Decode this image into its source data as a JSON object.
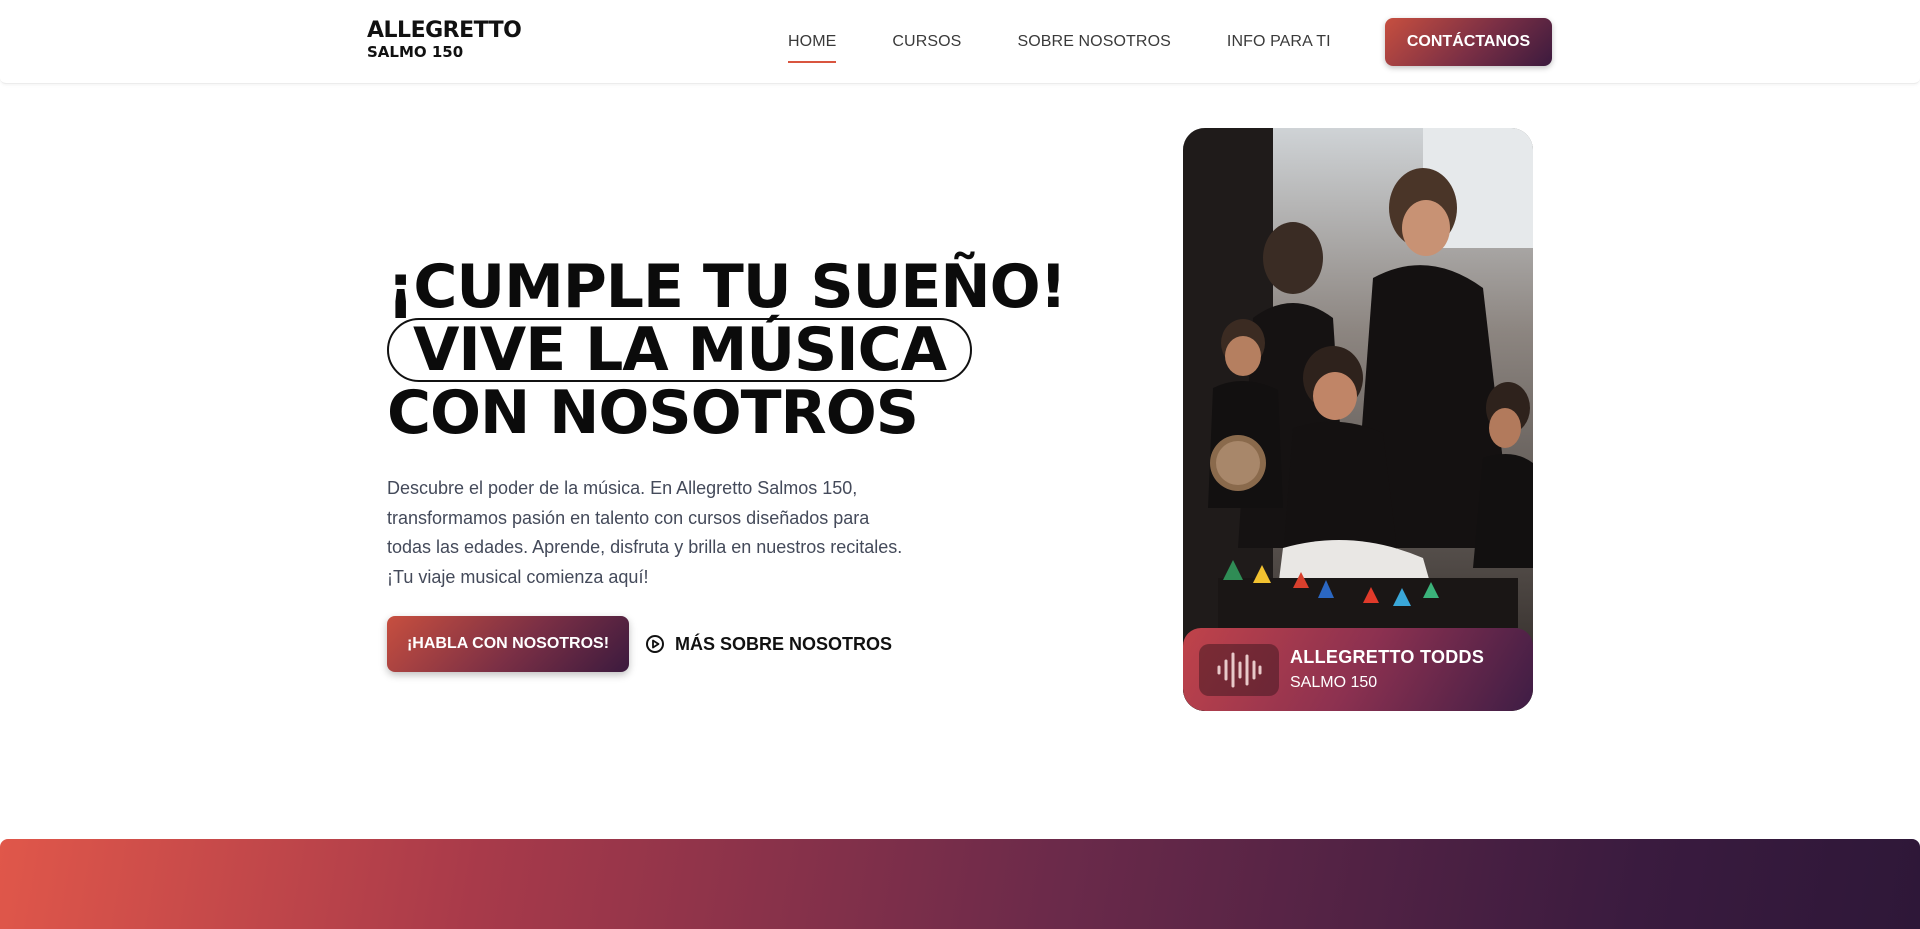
{
  "brand": {
    "name": "ALLEGRETTO",
    "sub": "SALMO 150"
  },
  "nav": {
    "items": [
      {
        "label": "HOME",
        "active": true
      },
      {
        "label": "CURSOS",
        "active": false
      },
      {
        "label": "SOBRE NOSOTROS",
        "active": false
      },
      {
        "label": "INFO PARA TI",
        "active": false
      }
    ],
    "cta": "CONTÁCTANOS"
  },
  "hero": {
    "title_line1": "¡CUMPLE TU SUEÑO!",
    "title_line2": "VIVE LA MÚSICA",
    "title_line3": "CON NOSOTROS",
    "description": "Descubre el poder de la música. En Allegretto Salmos 150, transformamos pasión en talento con cursos diseñados para todas las edades. Aprende, disfruta y brilla en nuestros recitales. ¡Tu viaje musical comienza aquí!",
    "primary_button": "¡HABLA CON NOSOTROS!",
    "secondary_button": "MÁS SOBRE NOSOTROS"
  },
  "card": {
    "title": "ALLEGRETTO TODDS",
    "subtitle": "SALMO 150",
    "icon": "sound-wave-icon"
  },
  "colors": {
    "accent": "#d9553f",
    "gradient_start": "#c74f3f",
    "gradient_end": "#3b1a3e"
  }
}
